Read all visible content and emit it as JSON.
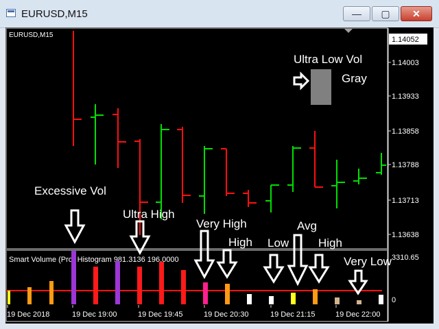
{
  "window": {
    "title": "EURUSD,M15",
    "minimize_label": "—",
    "maximize_label": "▢",
    "close_label": "✕"
  },
  "chart": {
    "symbol_label": "EURUSD,M15",
    "price_labels": [
      "1.14052",
      "1.14003",
      "1.13933",
      "1.13858",
      "1.13788",
      "1.13713",
      "1.13638"
    ],
    "current_price": "1.14052",
    "indicator_label": "Smart Volume (Pro) Histogram 981.3136 196.0000",
    "indicator_max": "3310.65",
    "indicator_zero": "0",
    "time_labels": [
      "19 Dec 2018",
      "19 Dec 19:00",
      "19 Dec 19:45",
      "19 Dec 20:30",
      "19 Dec 21:15",
      "19 Dec 22:00"
    ]
  },
  "annotations": {
    "excessive": "Excessive Vol",
    "ultra_high": "Ultra High",
    "very_high": "Very High",
    "high_1": "High",
    "low": "Low",
    "avg": "Avg",
    "high_2": "High",
    "very_low": "Very Low",
    "ultra_low": "Ultra Low Vol",
    "gray": "Gray"
  },
  "colors": {
    "bull": "#00e000",
    "bear": "#ff1010",
    "excessive": "#9c36d6",
    "ultra_high": "#ff1a1a",
    "very_high": "#ff1f8e",
    "high": "#ff9b12",
    "avg": "#ffff1a",
    "low": "#ffffff",
    "very_low": "#d2b48c",
    "ultra_low": "#808080"
  }
}
